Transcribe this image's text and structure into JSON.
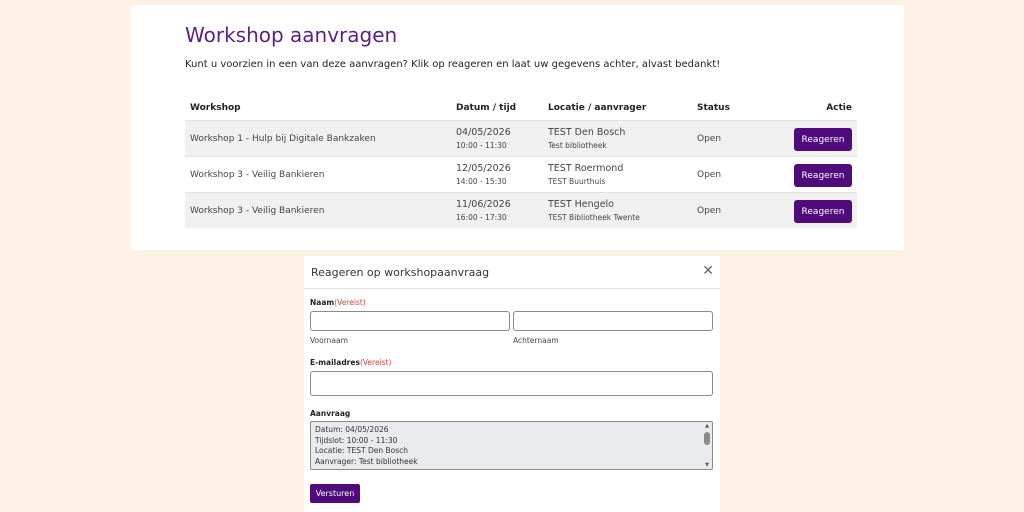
{
  "page": {
    "title": "Workshop aanvragen",
    "intro": "Kunt u voorzien in een van deze aanvragen? Klik op reageren en laat uw gegevens achter, alvast bedankt!"
  },
  "table": {
    "headers": {
      "workshop": "Workshop",
      "datum": "Datum / tijd",
      "locatie": "Locatie / aanvrager",
      "status": "Status",
      "actie": "Actie"
    },
    "rows": [
      {
        "workshop": "Workshop 1 - Hulp bij Digitale Bankzaken",
        "date": "04/05/2026",
        "time": "10:00 - 11:30",
        "location": "TEST Den Bosch",
        "requester": "Test bibliotheek",
        "status": "Open",
        "action": "Reageren"
      },
      {
        "workshop": "Workshop 3 - Veilig Bankieren",
        "date": "12/05/2026",
        "time": "14:00 - 15:30",
        "location": "TEST Roermond",
        "requester": "TEST Buurthuis",
        "status": "Open",
        "action": "Reageren"
      },
      {
        "workshop": "Workshop 3 - Veilig Bankieren",
        "date": "11/06/2026",
        "time": "16:00 - 17:30",
        "location": "TEST Hengelo",
        "requester": "TEST Bibliotheek Twente",
        "status": "Open",
        "action": "Reageren"
      }
    ]
  },
  "modal": {
    "title": "Reageren op workshopaanvraag",
    "close": "✕",
    "name_label": "Naam",
    "required": "(Vereist)",
    "first_name_value": "",
    "last_name_value": "",
    "first_name_sub": "Voornaam",
    "last_name_sub": "Achternaam",
    "email_label": "E-mailadres",
    "email_value": "",
    "request_label": "Aanvraag",
    "request_lines": [
      "Datum: 04/05/2026",
      "Tijdslot: 10:00 - 11:30",
      "Locatie: TEST Den Bosch",
      "Aanvrager: Test bibliotheek"
    ],
    "submit": "Versturen"
  },
  "colors": {
    "brand_purple": "#4f0b7b",
    "title_purple": "#5b1f86",
    "required_red": "#d04646",
    "page_bg": "#fdf1e6"
  }
}
